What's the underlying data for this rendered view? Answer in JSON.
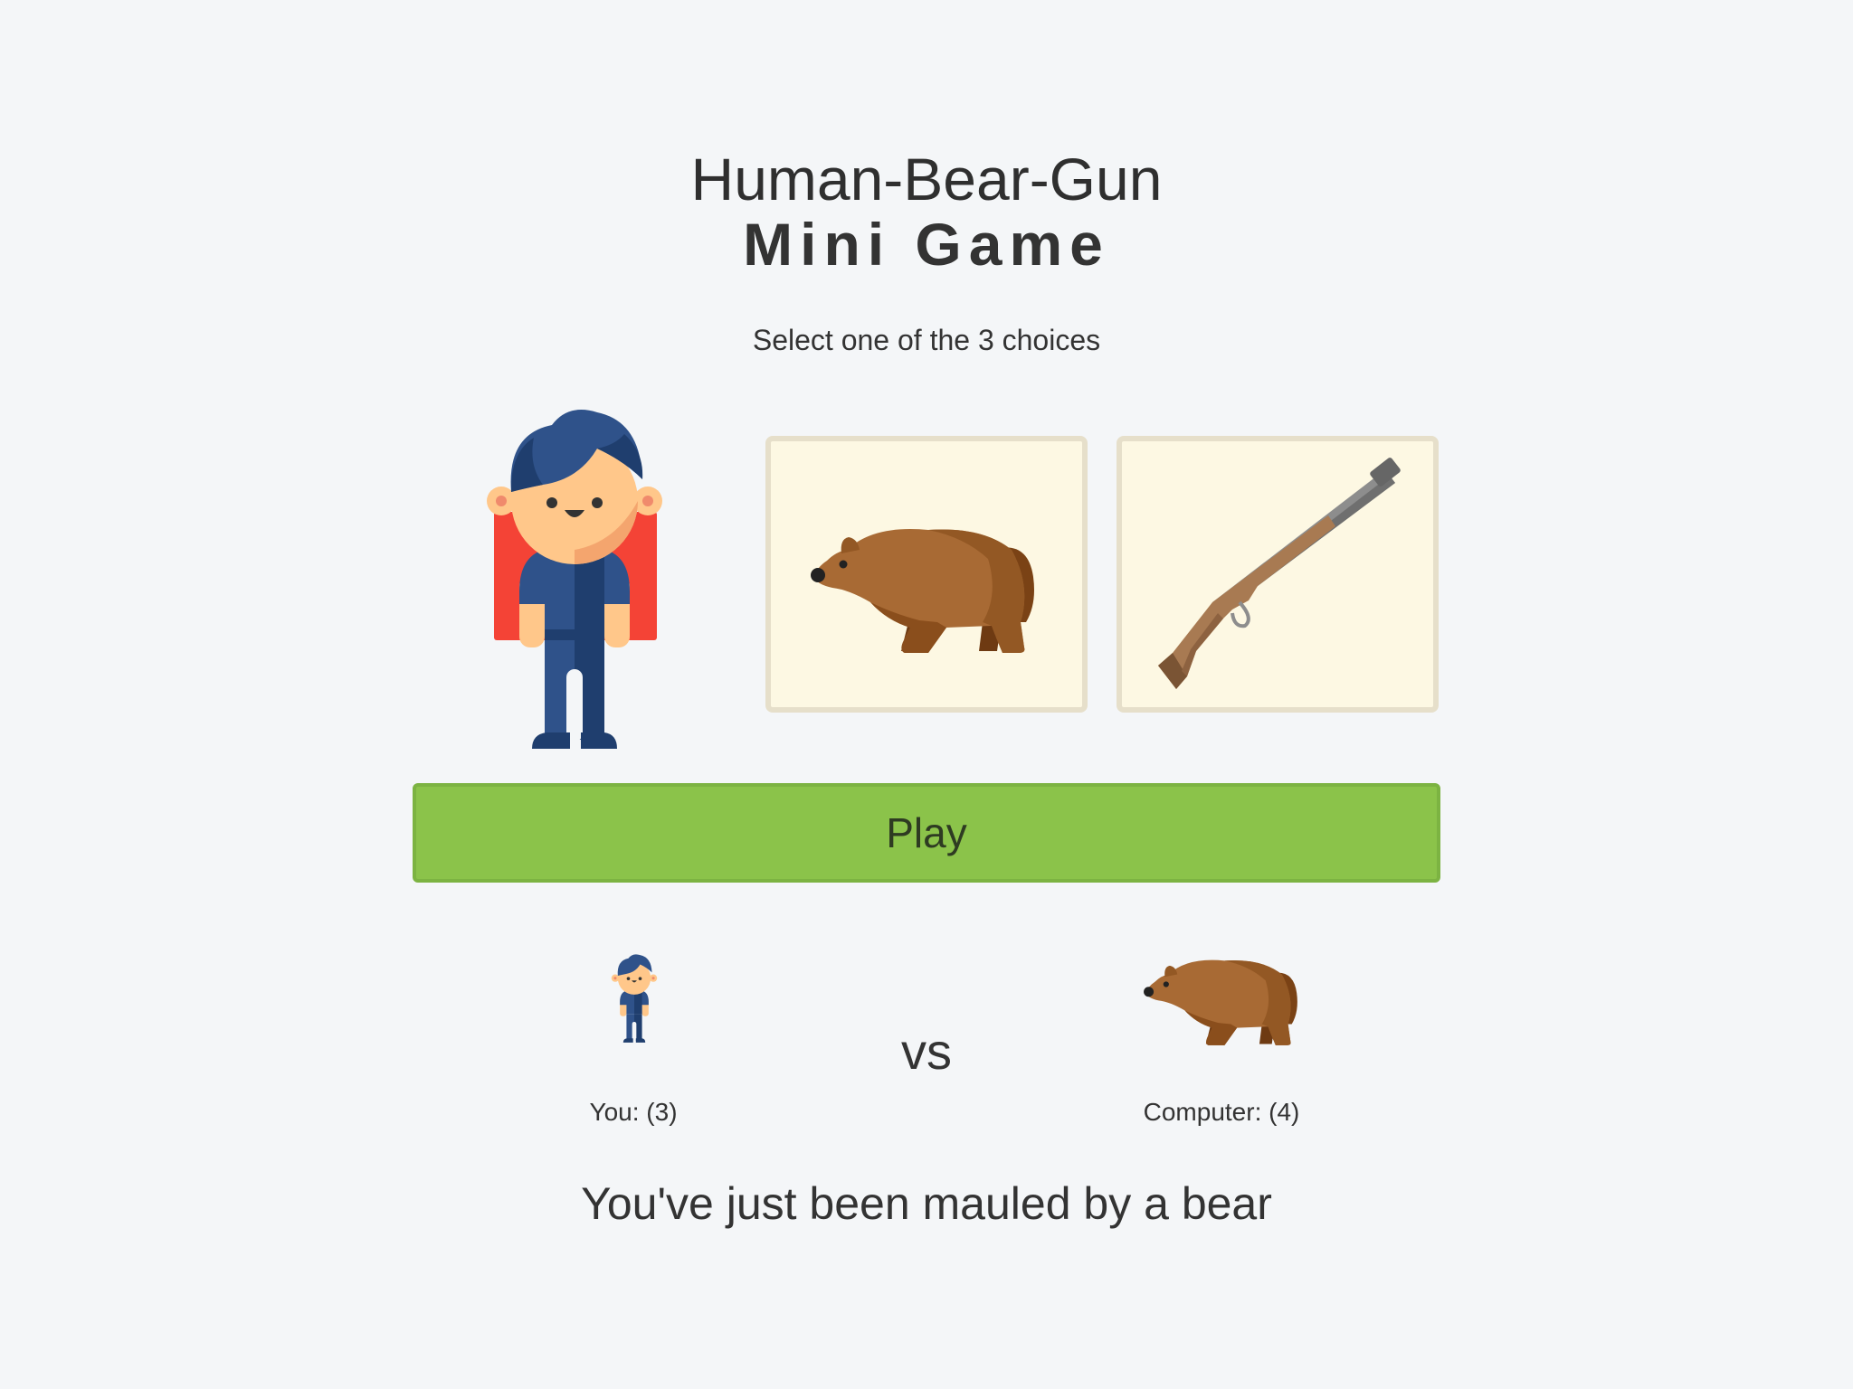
{
  "header": {
    "title": "Human-Bear-Gun",
    "subtitle": "Mini Game"
  },
  "instruction": "Select one of the 3 choices",
  "choices": [
    {
      "name": "human",
      "icon": "human-icon",
      "selected": false
    },
    {
      "name": "bear",
      "icon": "bear-icon",
      "selected": false
    },
    {
      "name": "gun",
      "icon": "gun-icon",
      "selected": false
    }
  ],
  "play_button": {
    "label": "Play",
    "color": "#8bc34a"
  },
  "battle": {
    "player_choice_icon": "human-icon",
    "computer_choice_icon": "bear-icon",
    "vs_label": "vs",
    "player_score_label": "You: (3)",
    "computer_score_label": "Computer: (4)"
  },
  "result_message": "You've just been mauled by a bear",
  "colors": {
    "background": "#f4f6f8",
    "card_background": "#fdf8e3",
    "card_border": "#e6dfca",
    "button": "#8bc34a"
  }
}
